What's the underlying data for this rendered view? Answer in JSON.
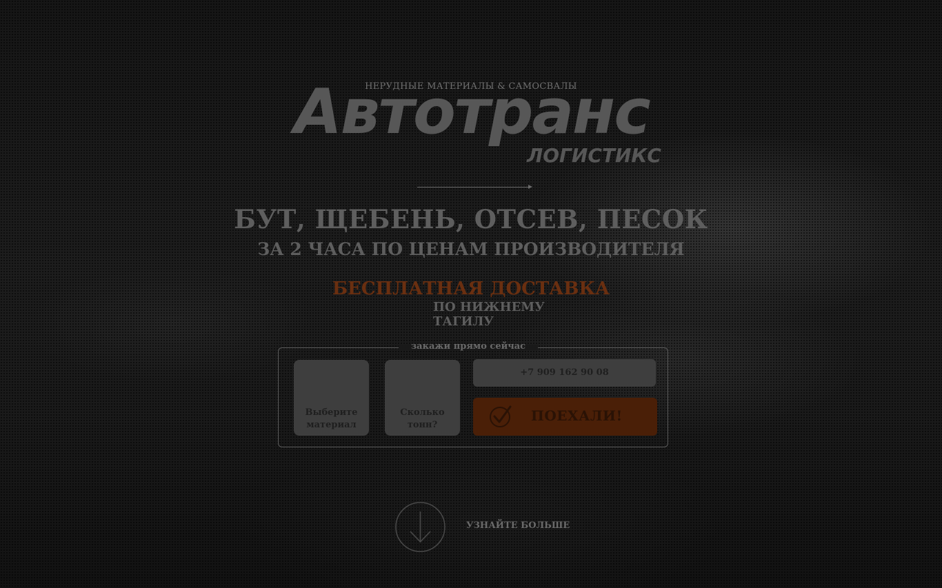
{
  "header": {
    "tagline": "НЕРУДНЫЕ МАТЕРИАЛЫ & САМОСВАЛЫ",
    "logo_main": "Автотранс",
    "logo_sub": "ЛОГИСТИКС"
  },
  "hero": {
    "headline": "БУТ, ЩЕБЕНЬ, ОТСЕВ, ПЕСОК",
    "subheadline": "ЗА 2 ЧАСА ПО ЦЕНАМ ПРОИЗВОДИТЕЛЯ",
    "delivery": "БЕСПЛАТНАЯ ДОСТАВКА",
    "delivery_city": "ПО НИЖНЕМУ ТАГИЛУ"
  },
  "order_form": {
    "legend": "закажи прямо сейчас",
    "material_select": {
      "label_line1": "Выберите",
      "label_line2": "материал"
    },
    "tons_select": {
      "label_line1": "Сколько",
      "label_line2": "тонн?"
    },
    "phone": {
      "value": "+7 909 162 90 08"
    },
    "submit_label": "ПОЕХАЛИ!",
    "submit_icon": "check-circle-icon"
  },
  "learn_more": {
    "label": "УЗНАЙТЕ БОЛЬШЕ",
    "icon": "arrow-down-circle-icon"
  },
  "colors": {
    "background": "#141414",
    "text_muted": "#5e5e5e",
    "accent": "#6a2f10",
    "button_bg": "#4a1f07",
    "field_bg": "#3e3e3e"
  }
}
